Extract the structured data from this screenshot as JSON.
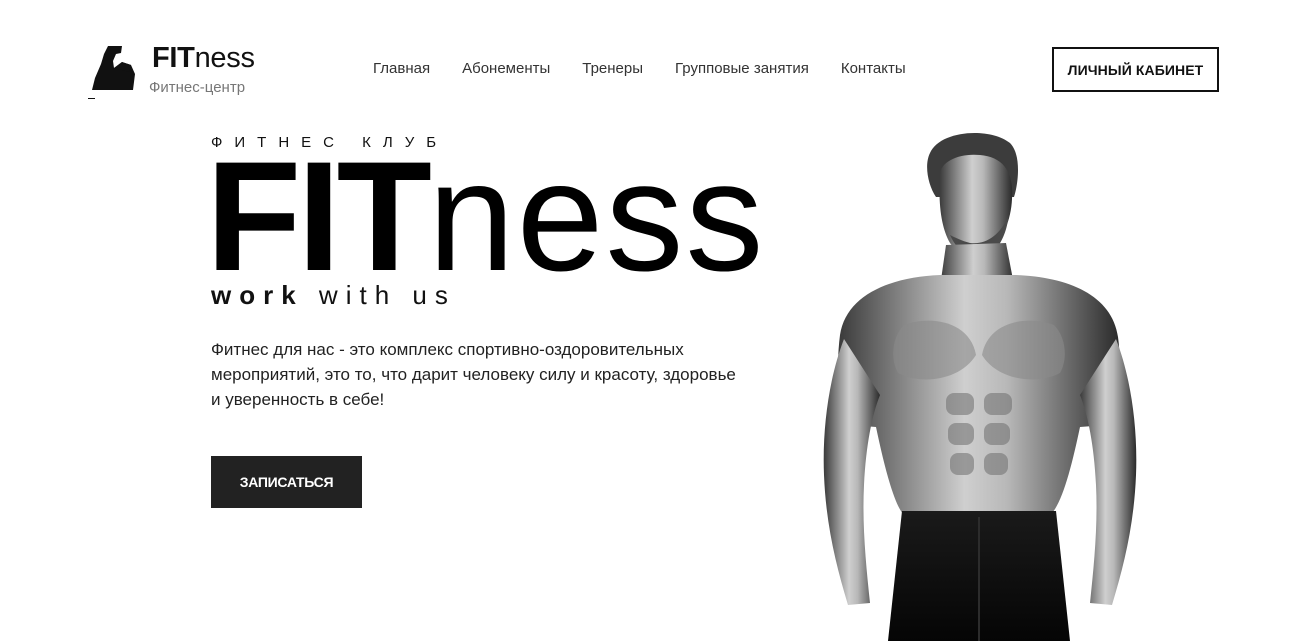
{
  "header": {
    "brand_bold": "FIT",
    "brand_light": "ness",
    "subtitle": "Фитнес-центр",
    "nav": [
      {
        "label": "Главная"
      },
      {
        "label": "Абонементы"
      },
      {
        "label": "Тренеры"
      },
      {
        "label": "Групповые занятия"
      },
      {
        "label": "Контакты"
      }
    ],
    "cabinet_label": "ЛИЧНЫЙ КАБИНЕТ"
  },
  "hero": {
    "kicker": "ФИТНЕС КЛУБ",
    "title_bold": "FIT",
    "title_light": "ness",
    "tagline_bold": "work",
    "tagline_rest": "with us",
    "description": "Фитнес для нас - это комплекс спортивно-оздоровительных мероприятий, это то, что дарит человеку силу и красоту, здоровье и уверенность в себе!",
    "signup_label": "ЗАПИСАТЬСЯ"
  },
  "icons": {
    "logo": "flexed-arm-icon"
  },
  "colors": {
    "primary": "#111111",
    "button_dark": "#222222",
    "muted_text": "#777777",
    "background": "#ffffff"
  }
}
